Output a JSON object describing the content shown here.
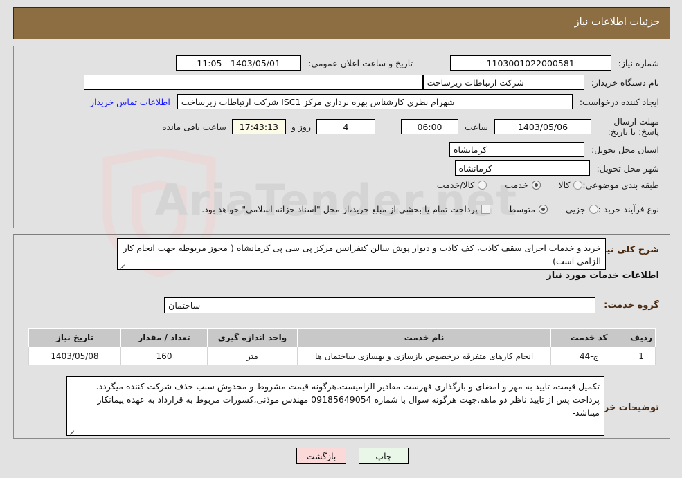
{
  "header": {
    "title": "جزئیات اطلاعات نیاز"
  },
  "form": {
    "need_number": {
      "label": "شماره نیاز:",
      "value": "1103001022000581"
    },
    "public_announce": {
      "label": "تاریخ و ساعت اعلان عمومی:",
      "value": "1403/05/01 - 11:05"
    },
    "buyer_org": {
      "label": "نام دستگاه خریدار:",
      "value": "شرکت ارتباطات زیرساخت"
    },
    "empty_field": {
      "value": ""
    },
    "requester": {
      "label": "ایجاد کننده درخواست:",
      "value": "شهرام نظری کارشناس بهره برداری مرکز ISC1 شرکت ارتباطات زیرساخت"
    },
    "contact_link": {
      "label": "اطلاعات تماس خریدار"
    },
    "deadline": {
      "label": "مهلت ارسال پاسخ: تا تاریخ:",
      "date": "1403/05/06",
      "time_label": "ساعت",
      "time": "06:00",
      "days": "4",
      "days_label": "روز و",
      "countdown": "17:43:13",
      "remaining_label": "ساعت باقی مانده"
    },
    "province": {
      "label": "استان محل تحویل:",
      "value": "کرمانشاه"
    },
    "city": {
      "label": "شهر محل تحویل:",
      "value": "کرمانشاه"
    },
    "category": {
      "label": "طبقه بندی موضوعی:",
      "options": [
        {
          "text": "کالا",
          "selected": false
        },
        {
          "text": "خدمت",
          "selected": true
        },
        {
          "text": "کالا/خدمت",
          "selected": false
        }
      ]
    },
    "process_type": {
      "label": "نوع فرآیند خرید :",
      "options": [
        {
          "text": "جزیی",
          "selected": false
        },
        {
          "text": "متوسط",
          "selected": true
        }
      ],
      "treasury_note": "پرداخت تمام یا بخشی از مبلغ خرید،از محل \"اسناد خزانه اسلامی\" خواهد بود.",
      "treasury_checked": false
    },
    "general_desc": {
      "label": "شرح کلی نیاز:",
      "value": "خرید و خدمات اجرای سقف کاذب، کف کاذب و دیوار پوش سالن کنفرانس مرکز پی سی پی کرمانشاه ( مجوز مربوطه جهت انجام کار الزامی است)"
    },
    "services_heading": "اطلاعات خدمات مورد نیاز",
    "service_group": {
      "label": "گروه خدمت:",
      "value": "ساختمان"
    },
    "buyer_notes": {
      "label": "توضیحات خریدار:",
      "value": "تکمیل قیمت، تایید به مهر و امضای و بارگذاری  فهرست مقادیر الزامیست.هرگونه قیمت مشروط و مخدوش سبب حذف شرکت کننده میگردد. پرداخت پس از تایید ناظر دو ماهه.جهت هرگونه سوال با شماره 09185649054 مهندس موذنی،کسورات مربوط به قرارداد به عهده پیمانکار میباشد-"
    }
  },
  "table": {
    "columns": [
      "ردیف",
      "کد خدمت",
      "نام خدمت",
      "واحد اندازه گیری",
      "تعداد / مقدار",
      "تاریخ نیاز"
    ],
    "rows": [
      {
        "row_no": "1",
        "service_code": "ج-44",
        "service_name": "انجام کارهای متفرقه درخصوص بازسازی و بهسازی ساختمان ها",
        "unit": "متر",
        "qty": "160",
        "need_date": "1403/05/08"
      }
    ]
  },
  "buttons": {
    "print": "چاپ",
    "back": "بازگشت"
  },
  "watermark": {
    "text": "AriaTender.net"
  },
  "colors": {
    "header_bg": "#8c6e42",
    "page_bg": "#e2e2e2",
    "link": "#1a1aff",
    "label_strong": "#4a2a10",
    "timer_bg": "#fbfbe8",
    "print_btn_bg": "#e9f7e9",
    "back_btn_bg": "#fcd9d9",
    "table_header_bg": "#c8c8c8"
  }
}
